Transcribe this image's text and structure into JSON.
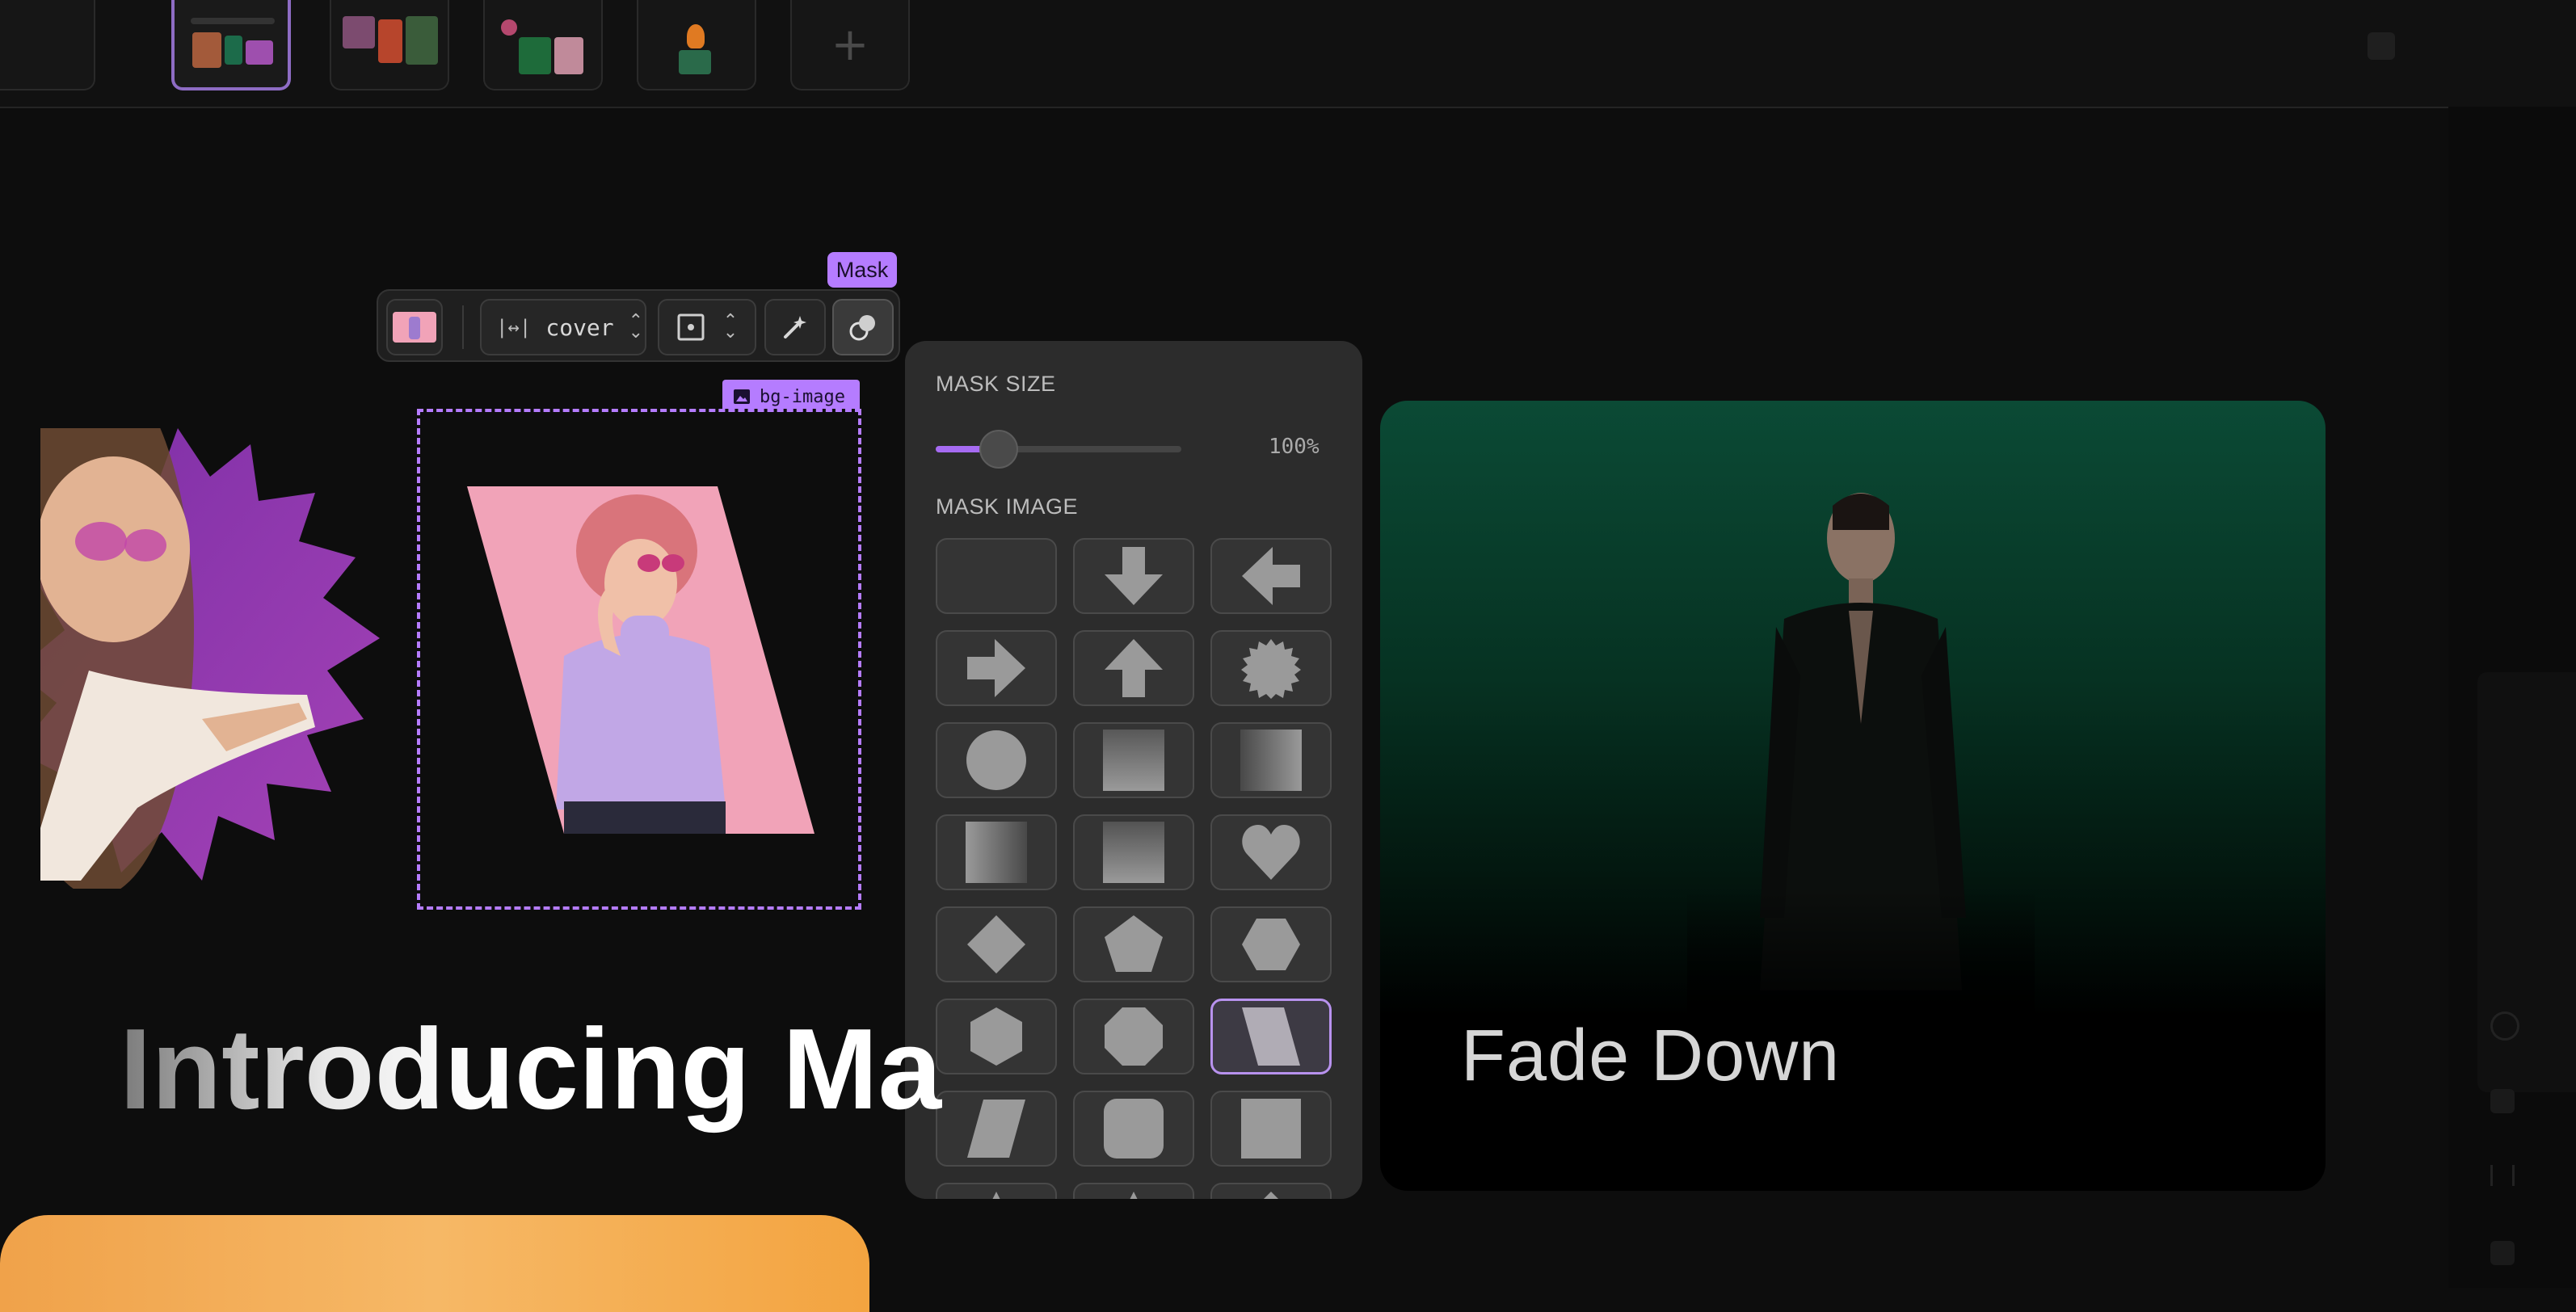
{
  "toolbar": {
    "fit_value": "cover",
    "tooltip": "Mask"
  },
  "frame": {
    "label": "bg-image"
  },
  "mask_popover": {
    "size_heading": "MASK SIZE",
    "size_value": "100%",
    "size_fraction": 0.25,
    "image_heading": "MASK IMAGE",
    "shapes": [
      "none",
      "arrow-down",
      "arrow-left",
      "arrow-right",
      "arrow-up",
      "burst",
      "circle",
      "gradient-top",
      "gradient-right",
      "gradient-left",
      "gradient-bottom",
      "heart",
      "diamond",
      "pentagon",
      "hexagon-flat",
      "hexagon-pointy",
      "octagon",
      "parallelogram-right",
      "parallelogram-left",
      "rounded-square",
      "square"
    ],
    "selected_shape": "parallelogram-right"
  },
  "card": {
    "title": "Fade Down"
  },
  "headline": "Introducing Ma",
  "colors": {
    "accent": "#b57cff",
    "background": "#0d0d0d",
    "popover": "#2c2c2c",
    "card_green": "#0b4a35"
  }
}
